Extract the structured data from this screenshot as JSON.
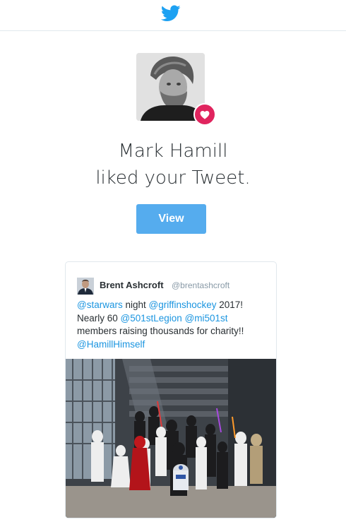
{
  "header": {
    "logo_icon": "twitter-bird-icon",
    "brand_color": "#1da1f2"
  },
  "notification": {
    "avatar_icon": "mark-hamill-avatar",
    "badge_icon": "heart-icon",
    "badge_color": "#e0245e",
    "name": "Mark Hamill",
    "action": "liked your Tweet.",
    "view_label": "View",
    "view_color": "#55acee"
  },
  "tweet": {
    "author_name": "Brent Ashcroft",
    "author_handle": "@brentashcroft",
    "mention_1": "@starwars",
    "text_1": " night ",
    "mention_2": "@griffinshockey",
    "text_2": " 2017! Nearly 60 ",
    "mention_3": "@501stLegion",
    "text_3": " ",
    "mention_4": "@mi501st",
    "text_4": " members raising thousands for charity!! ",
    "mention_5": "@HamillHimself",
    "mention_color": "#1b95e0",
    "photo_icon": "star-wars-costume-group-photo"
  }
}
